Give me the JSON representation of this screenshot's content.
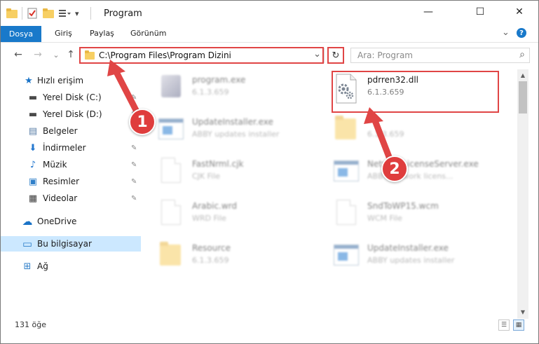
{
  "window": {
    "title": "Program",
    "minimize_glyph": "—",
    "maximize_glyph": "☐",
    "close_glyph": "✕"
  },
  "ribbon": {
    "tabs": [
      "Dosya",
      "Giriş",
      "Paylaş",
      "Görünüm"
    ],
    "expand_glyph": "⌄",
    "help_glyph": "?"
  },
  "nav": {
    "back_glyph": "←",
    "forward_glyph": "→",
    "recent_glyph": "⌄",
    "up_glyph": "↑",
    "address": "C:\\Program Files\\Program Dizini",
    "address_dropdown_glyph": "⌄",
    "refresh_glyph": "↻",
    "search_placeholder": "Ara: Program",
    "search_glyph": "⌕"
  },
  "sidebar": {
    "items": [
      {
        "label": "Hızlı erişim",
        "icon": "star-icon",
        "glyph": "★",
        "color": "#1a73c7",
        "pinned": false
      },
      {
        "label": "Yerel Disk (C:)",
        "icon": "drive-icon",
        "glyph": "▬",
        "color": "#4a4a4a",
        "pinned": true
      },
      {
        "label": "Yerel Disk (D:)",
        "icon": "drive-icon",
        "glyph": "▬",
        "color": "#4a4a4a",
        "pinned": true
      },
      {
        "label": "Belgeler",
        "icon": "documents-icon",
        "glyph": "▤",
        "color": "#5b7fa8",
        "pinned": true
      },
      {
        "label": "İndirmeler",
        "icon": "download-icon",
        "glyph": "⬇",
        "color": "#2477cf",
        "pinned": true
      },
      {
        "label": "Müzik",
        "icon": "music-icon",
        "glyph": "♪",
        "color": "#2477cf",
        "pinned": true
      },
      {
        "label": "Resimler",
        "icon": "pictures-icon",
        "glyph": "▣",
        "color": "#2f7fc9",
        "pinned": true
      },
      {
        "label": "Videolar",
        "icon": "video-icon",
        "glyph": "▦",
        "color": "#3b3b3b",
        "pinned": true
      },
      {
        "label": "OneDrive",
        "icon": "cloud-icon",
        "glyph": "☁",
        "color": "#1a73c7",
        "pinned": false
      },
      {
        "label": "Bu bilgisayar",
        "icon": "computer-icon",
        "glyph": "▭",
        "color": "#2f7fc9",
        "pinned": false
      },
      {
        "label": "Ağ",
        "icon": "network-icon",
        "glyph": "⊞",
        "color": "#2f7fc9",
        "pinned": false
      }
    ],
    "pin_glyph": "✎"
  },
  "files": [
    {
      "name": "program.exe",
      "sub": "6.1.3.659",
      "icon": "exe-icon",
      "blurred": true
    },
    {
      "name": "pdrren32.dll",
      "sub": "6.1.3.659",
      "icon": "dll-gear-icon",
      "blurred": false
    },
    {
      "name": "UpdateInstaller.exe",
      "sub": "ABBY updates installer",
      "icon": "app-window-icon",
      "blurred": true
    },
    {
      "name": "",
      "sub": "6.1.3.659",
      "icon": "folder-icon",
      "blurred": true
    },
    {
      "name": "FastNrml.cjk",
      "sub": "CJK File",
      "icon": "document-icon",
      "blurred": true
    },
    {
      "name": "NetworkLicenseServer.exe",
      "sub": "ABBY network licens...",
      "icon": "app-window-icon",
      "blurred": true
    },
    {
      "name": "Arabic.wrd",
      "sub": "WRD File",
      "icon": "document-icon",
      "blurred": true
    },
    {
      "name": "SndToWP15.wcm",
      "sub": "WCM File",
      "icon": "document-icon",
      "blurred": true
    },
    {
      "name": "Resource",
      "sub": "6.1.3.659",
      "icon": "folder-icon",
      "blurred": true
    },
    {
      "name": "UpdateInstaller.exe",
      "sub": "ABBY updates installer",
      "icon": "app-window-icon",
      "blurred": true
    }
  ],
  "status": {
    "count": "131 öğe",
    "details_view_glyph": "☰",
    "icons_view_glyph": "▦"
  },
  "scrollbar": {
    "up_glyph": "▲",
    "down_glyph": "▼"
  },
  "callouts": [
    {
      "number": "1"
    },
    {
      "number": "2"
    }
  ],
  "colors": {
    "accent": "#1979ca",
    "highlight_red": "#e04545",
    "callout_red": "#df3d3d",
    "selection": "#cce8ff"
  }
}
